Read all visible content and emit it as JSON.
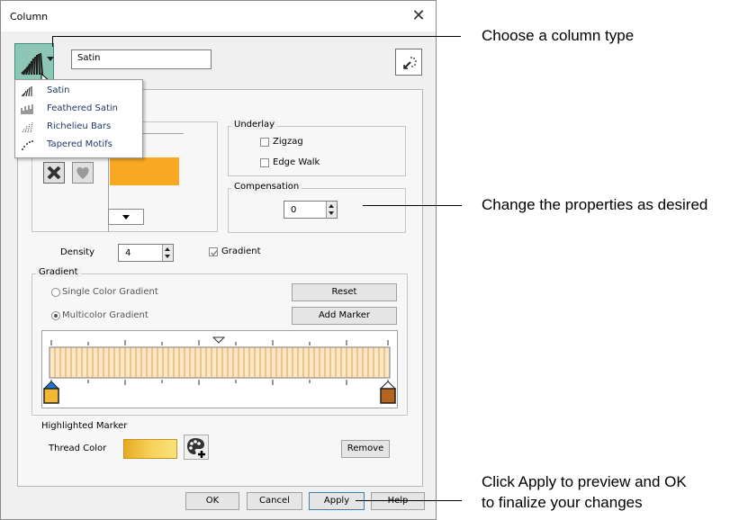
{
  "dialog": {
    "title": "Column",
    "column_name": "Satin",
    "type_menu": [
      "Satin",
      "Feathered Satin",
      "Richelieu Bars",
      "Tapered Motifs"
    ],
    "underlay": {
      "legend": "Underlay",
      "options": [
        {
          "label": "Zigzag",
          "checked": false
        },
        {
          "label": "Edge Walk",
          "checked": false
        }
      ]
    },
    "compensation": {
      "legend": "Compensation",
      "value": "0"
    },
    "density": {
      "label": "Density",
      "value": "4"
    },
    "gradient_checkbox": {
      "label": "Gradient",
      "checked": true
    },
    "gradient": {
      "legend": "Gradient",
      "single_label": "Single Color Gradient",
      "multi_label": "Multicolor Gradient",
      "selected": "multi",
      "reset_label": "Reset",
      "add_marker_label": "Add Marker",
      "left_marker_color": "#f4b633",
      "right_marker_color": "#b5651d"
    },
    "highlighted_marker": {
      "title": "Highlighted Marker",
      "thread_color_label": "Thread Color",
      "remove_label": "Remove"
    },
    "buttons": {
      "ok": "OK",
      "cancel": "Cancel",
      "apply": "Apply",
      "help": "Help"
    },
    "colors": {
      "accent": "#8dc6b4",
      "swatch": "#f8a821"
    }
  },
  "annotations": {
    "type": "Choose a column type",
    "properties": "Change the properties as desired",
    "apply_line1": "Click Apply to preview and OK",
    "apply_line2": "to finalize your changes"
  }
}
